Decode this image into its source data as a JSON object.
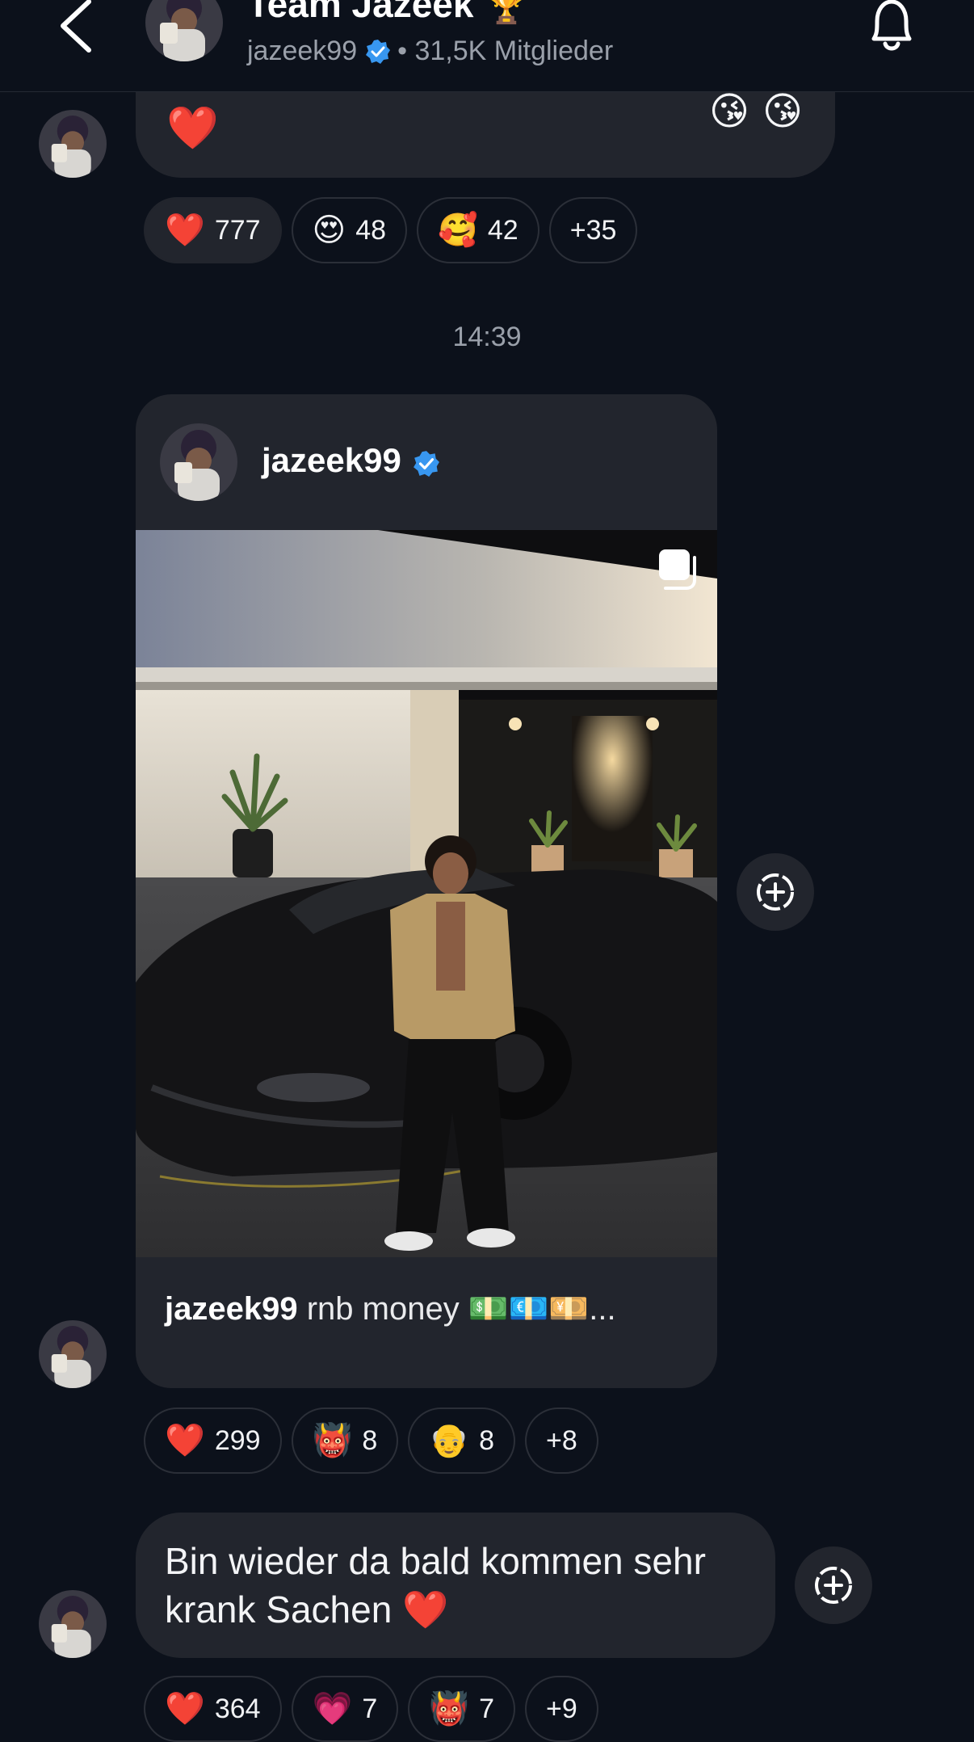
{
  "header": {
    "title": "Team Jazeek",
    "title_emoji": "🏆",
    "handle": "jazeek99",
    "members": "• 31,5K Mitglieder"
  },
  "top_message": {
    "heart": "❤️",
    "partial_emojis": [
      "😘",
      "😘"
    ],
    "reactions": [
      {
        "emoji": "❤️",
        "count": "777"
      },
      {
        "emoji": "😍",
        "count": "48"
      },
      {
        "emoji": "🥰",
        "count": "42"
      },
      {
        "emoji": "",
        "count": "+35"
      }
    ]
  },
  "timestamp": "14:39",
  "post": {
    "author": "jazeek99",
    "caption_author": "jazeek99",
    "caption_text": "rnb money 💵💶💴...",
    "reactions": [
      {
        "emoji": "❤️",
        "count": "299"
      },
      {
        "emoji": "👹",
        "count": "8"
      },
      {
        "emoji": "👴",
        "count": "8"
      },
      {
        "emoji": "",
        "count": "+8"
      }
    ]
  },
  "text_message": {
    "text": "Bin wieder da bald kommen sehr krank Sachen ❤️",
    "reactions": [
      {
        "emoji": "❤️",
        "count": "364"
      },
      {
        "emoji": "💗",
        "count": "7"
      },
      {
        "emoji": "👹",
        "count": "7"
      },
      {
        "emoji": "",
        "count": "+9"
      }
    ]
  },
  "icons": {
    "back": "chevron-left-icon",
    "bell": "bell-icon",
    "verified": "verified-badge-icon",
    "add_reaction": "add-reaction-icon",
    "multi_image": "multi-image-icon"
  },
  "colors": {
    "background": "#0c111b",
    "bubble": "#22252d",
    "verified": "#3897f0",
    "muted_text": "#9aa0aa"
  }
}
